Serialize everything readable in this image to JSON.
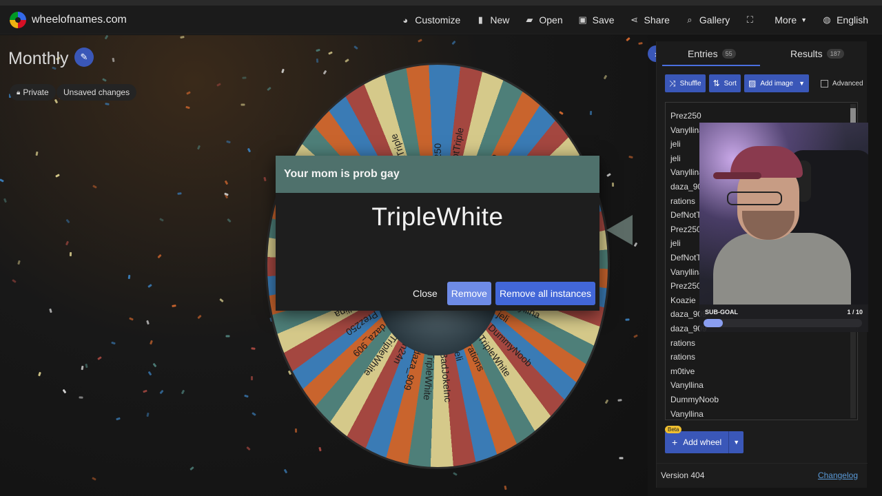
{
  "header": {
    "site_name": "wheelofnames.com",
    "nav": [
      {
        "label": "Customize",
        "icon": "palette-icon"
      },
      {
        "label": "New",
        "icon": "file-icon"
      },
      {
        "label": "Open",
        "icon": "folder-icon"
      },
      {
        "label": "Save",
        "icon": "save-icon"
      },
      {
        "label": "Share",
        "icon": "share-icon"
      },
      {
        "label": "Gallery",
        "icon": "search-icon"
      },
      {
        "label": "",
        "icon": "fullscreen-icon"
      },
      {
        "label": "More",
        "icon": "chevron-down-icon"
      },
      {
        "label": "English",
        "icon": "globe-icon"
      }
    ]
  },
  "wheel": {
    "title": "Monthly",
    "private_label": "Private",
    "unsaved_label": "Unsaved changes",
    "labels": [
      "Prez250",
      "DefNotTriple",
      "rations",
      "daza_909",
      "Vanyllina",
      "jeli",
      "jeli",
      "Vanyllina",
      "Prez250",
      "jeli",
      "daza_909",
      "Vanyllina",
      "jeli",
      "DummyNoob",
      "TripleWhite",
      "rations",
      "jeli",
      "BadJokeInc",
      "TripleWhite",
      "daza_909",
      "n24n",
      "TripleWhite",
      "daza_909",
      "Prez250",
      "Vanyllina",
      "DummyNoob",
      "Vanyllina",
      "Prez250",
      "rations",
      "daza_909",
      "Koazie",
      "Prez250",
      "Vanyllina",
      "DefNotTriple",
      "jeli"
    ]
  },
  "dialog": {
    "title": "Your mom is prob gay",
    "winner": "TripleWhite",
    "close_label": "Close",
    "remove_label": "Remove",
    "remove_all_label": "Remove all instances"
  },
  "panel": {
    "tabs": {
      "entries_label": "Entries",
      "entries_count": "55",
      "results_label": "Results",
      "results_count": "187"
    },
    "toolbar": {
      "shuffle_label": "Shuffle",
      "sort_label": "Sort",
      "add_image_label": "Add image",
      "advanced_label": "Advanced"
    },
    "entries": [
      "Prez250",
      "Vanyllina",
      "jeli",
      "jeli",
      "Vanyllina",
      "daza_909",
      "rations",
      "DefNotTriple",
      "Prez250",
      "jeli",
      "DefNotTriple",
      "Vanyllina",
      "Prez250",
      "Koazie",
      "daza_909",
      "daza_909",
      "rations",
      "rations",
      "m0tive",
      "Vanyllina",
      "DummyNoob",
      "Vanyllina"
    ],
    "add_wheel_label": "Add wheel",
    "beta_label": "Beta",
    "version_label": "Version 404",
    "changelog_label": "Changelog"
  },
  "overlay": {
    "subgoal_label": "SUB-GOAL",
    "subgoal_count": "1 / 10",
    "subgoal_progress": 0.1
  },
  "colors": {
    "accent": "#3a57b8",
    "dialog_header": "#4f716c",
    "segment_blue": "#3a7bb5",
    "segment_red": "#a44740",
    "segment_cream": "#d5c98a",
    "segment_teal": "#4e7f79",
    "segment_orange": "#c9642d"
  }
}
